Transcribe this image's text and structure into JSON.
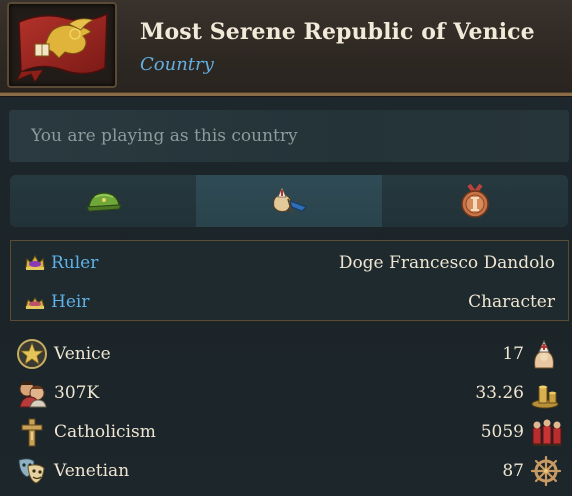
{
  "header": {
    "title": "Most Serene Republic of Venice",
    "subtitle": "Country",
    "flag_icon": "venice-flag-winged-lion",
    "accent_color": "#62aee0",
    "frame_color": "#8a6d46"
  },
  "banner": {
    "text": "You are playing as this country"
  },
  "tabs": [
    {
      "icon": "military-helmet-icon",
      "active": false
    },
    {
      "icon": "diplomacy-envoy-icon",
      "active": true
    },
    {
      "icon": "medal-icon",
      "active": false
    }
  ],
  "government": {
    "ruler_label": "Ruler",
    "ruler_value": "Doge Francesco Dandolo",
    "heir_label": "Heir",
    "heir_value": "Character"
  },
  "stats": [
    {
      "icon": "capital-star-icon",
      "label": "Venice",
      "value": "17",
      "value_icon": "clergy-icon"
    },
    {
      "icon": "population-icon",
      "label": "307K",
      "value": "33.26",
      "value_icon": "gold-coins-icon"
    },
    {
      "icon": "religion-cross-icon",
      "label": "Catholicism",
      "value": "5059",
      "value_icon": "soldiers-icon"
    },
    {
      "icon": "culture-masks-icon",
      "label": "Venetian",
      "value": "87",
      "value_icon": "ship-wheel-icon"
    }
  ]
}
